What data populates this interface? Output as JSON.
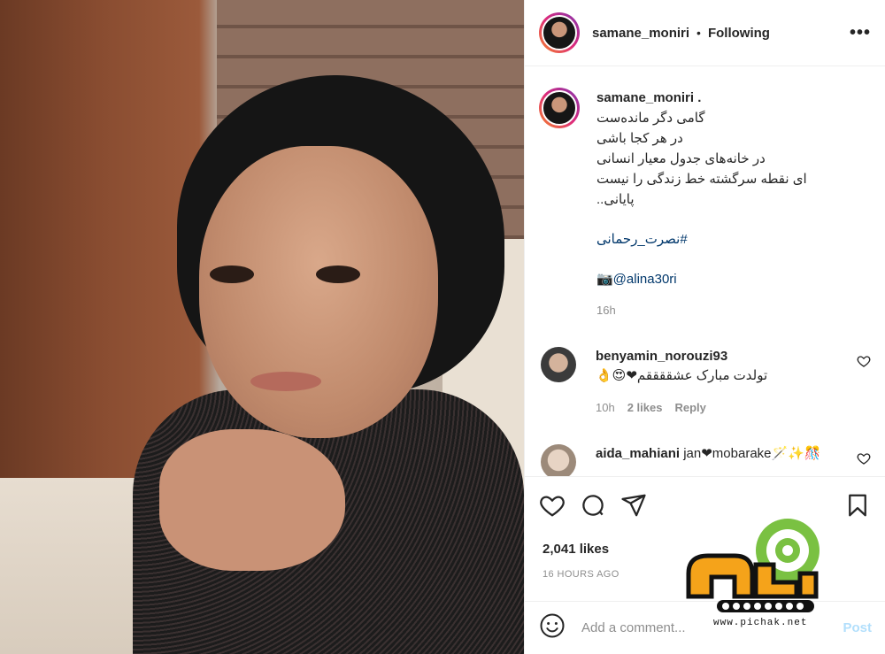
{
  "post": {
    "username": "samane_moniri",
    "separator": "•",
    "follow_status": "Following",
    "more_label": "•••"
  },
  "caption": {
    "username": "samane_moniri .",
    "lines": [
      "گامی دگر مانده‌ست",
      "در هر کجا باشی",
      "در خانه‌های جدول معیار انسانی",
      "ای نقطه سرگشته خط زندگی را نیست",
      "پایانی.."
    ],
    "hashtag": "#نصرت_رحمانی",
    "mention": "📷@alina30ri",
    "time": "16h"
  },
  "comments": [
    {
      "username": "benyamin_norouzi93",
      "text": "تولدت مبارک عشققققم❤😍👌",
      "time": "10h",
      "likes": "2 likes",
      "reply": "Reply"
    },
    {
      "username": "aida_mahiani",
      "text": "jan❤mobarake🪄✨🎊",
      "time": "",
      "likes": "",
      "reply": ""
    }
  ],
  "stats": {
    "likes": "2,041 likes",
    "ago": "16 HOURS AGO"
  },
  "input": {
    "placeholder": "Add a comment...",
    "post_label": "Post"
  },
  "watermark": {
    "site": "www.pichak.net"
  },
  "colors": {
    "link": "#00376b",
    "muted": "#8e8e8e",
    "post_disabled": "#b2dffc",
    "heart": "#ed4956"
  }
}
